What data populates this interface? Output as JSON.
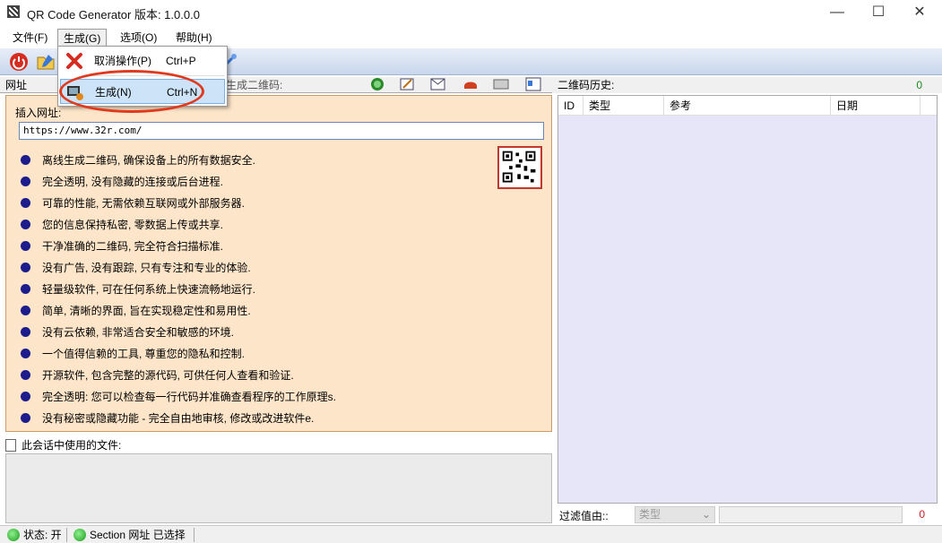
{
  "window": {
    "title": "QR Code Generator 版本: 1.0.0.0",
    "minimize": "—",
    "maximize": "☐",
    "close": "✕"
  },
  "menu": {
    "file": "文件(F)",
    "generate": "生成(G)",
    "options": "选项(O)",
    "help": "帮助(H)"
  },
  "dropdown": {
    "cancel_label": "取消操作(P)",
    "cancel_shortcut": "Ctrl+P",
    "generate_label": "生成(N)",
    "generate_shortcut": "Ctrl+N"
  },
  "toolbar_icons": [
    "power-icon",
    "open-folder-icon",
    "generate-icon"
  ],
  "left_panel": {
    "header": "网址",
    "header_partial": "生成二维码:",
    "insert_label": "插入网址:",
    "url_value": "https://www.32r.com/",
    "features": [
      "离线生成二维码, 确保设备上的所有数据安全.",
      "完全透明, 没有隐藏的连接或后台进程.",
      "可靠的性能, 无需依赖互联网或外部服务器.",
      "您的信息保持私密, 零数据上传或共享.",
      "干净准确的二维码, 完全符合扫描标准.",
      "没有广告, 没有跟踪, 只有专注和专业的体验.",
      "轻量级软件, 可在任何系统上快速流畅地运行.",
      "简单, 清晰的界面, 旨在实现稳定性和易用性.",
      "没有云依赖, 非常适合安全和敏感的环境.",
      "一个值得信赖的工具, 尊重您的隐私和控制.",
      "开源软件, 包含完整的源代码, 可供任何人查看和验证.",
      "完全透明: 您可以检查每一行代码并准确查看程序的工作原理s.",
      "没有秘密或隐藏功能 - 完全自由地审核, 修改或改进软件e."
    ],
    "files_header": "此会话中使用的文件:"
  },
  "right_panel": {
    "header": "二维码历史:",
    "count": "0",
    "columns": [
      "ID",
      "类型",
      "参考",
      "日期"
    ],
    "filter_label": "过滤值由::",
    "filter_select": "类型",
    "filter_count": "0"
  },
  "status": {
    "state": "状态: 开",
    "section": "Section 网址 已选择"
  },
  "colors": {
    "panel_bg": "#fde5c9",
    "bullet": "#1c1c8c",
    "highlight_ring": "#e03a1e",
    "history_bg": "#e6e6f8"
  }
}
